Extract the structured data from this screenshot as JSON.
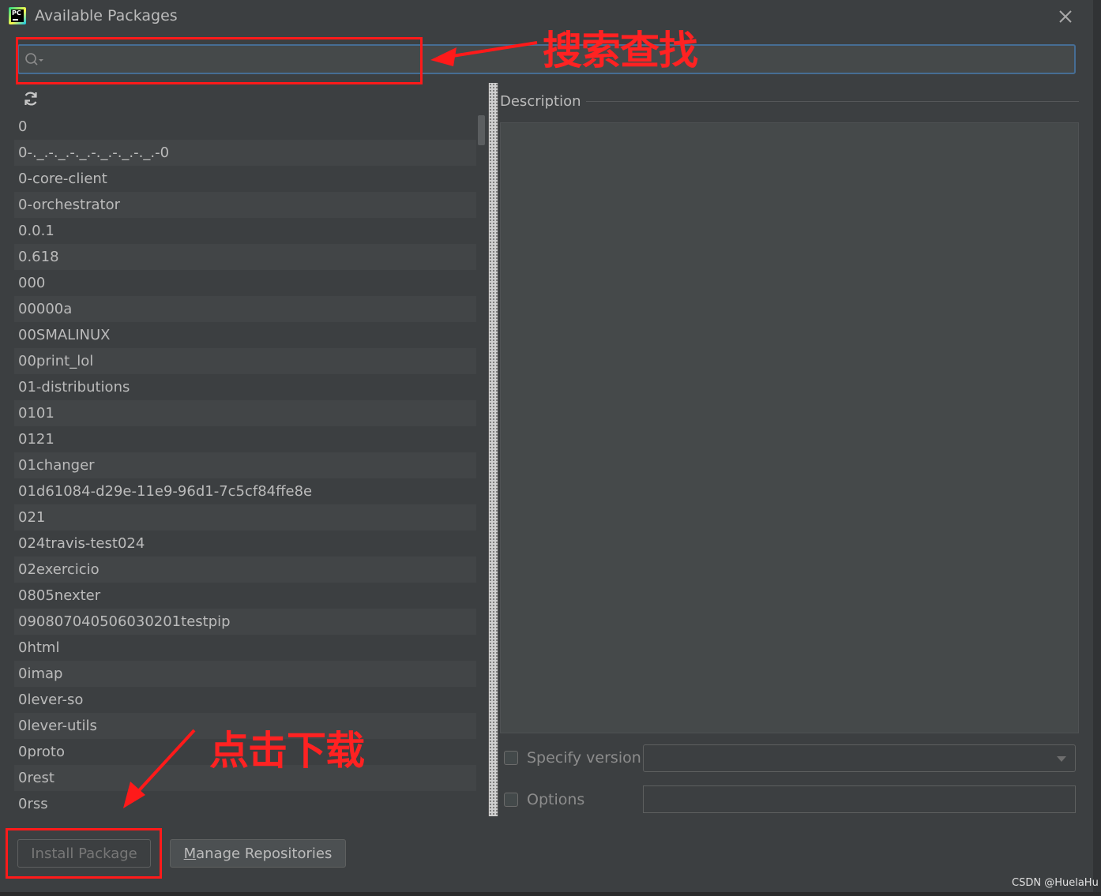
{
  "window": {
    "title": "Available Packages",
    "icon_text": "PC"
  },
  "search": {
    "value": "",
    "placeholder": ""
  },
  "packages": [
    "0",
    "0-._.-._.-._.-._.-._.-._.-0",
    "0-core-client",
    "0-orchestrator",
    "0.0.1",
    "0.618",
    "000",
    "00000a",
    "00SMALINUX",
    "00print_lol",
    "01-distributions",
    "0101",
    "0121",
    "01changer",
    "01d61084-d29e-11e9-96d1-7c5cf84ffe8e",
    "021",
    "024travis-test024",
    "02exercicio",
    "0805nexter",
    "090807040506030201testpip",
    "0html",
    "0imap",
    "0lever-so",
    "0lever-utils",
    "0proto",
    "0rest",
    "0rss"
  ],
  "description": {
    "label": "Description",
    "text": ""
  },
  "options": {
    "specify_version_label": "Specify version",
    "specify_version_checked": false,
    "version_value": "",
    "options_label": "Options",
    "options_checked": false,
    "options_value": ""
  },
  "buttons": {
    "install_label": "Install Package",
    "install_enabled": false,
    "manage_mnemonic": "M",
    "manage_rest": "anage Repositories"
  },
  "annotations": {
    "search_note": "搜索查找",
    "click_note": "点击下载",
    "color": "#ff1a1a"
  },
  "watermark": "CSDN @HuelaHu",
  "colors": {
    "window_bg": "#3c3f41",
    "focus_border": "#466d94",
    "text": "#bbbbbb"
  }
}
